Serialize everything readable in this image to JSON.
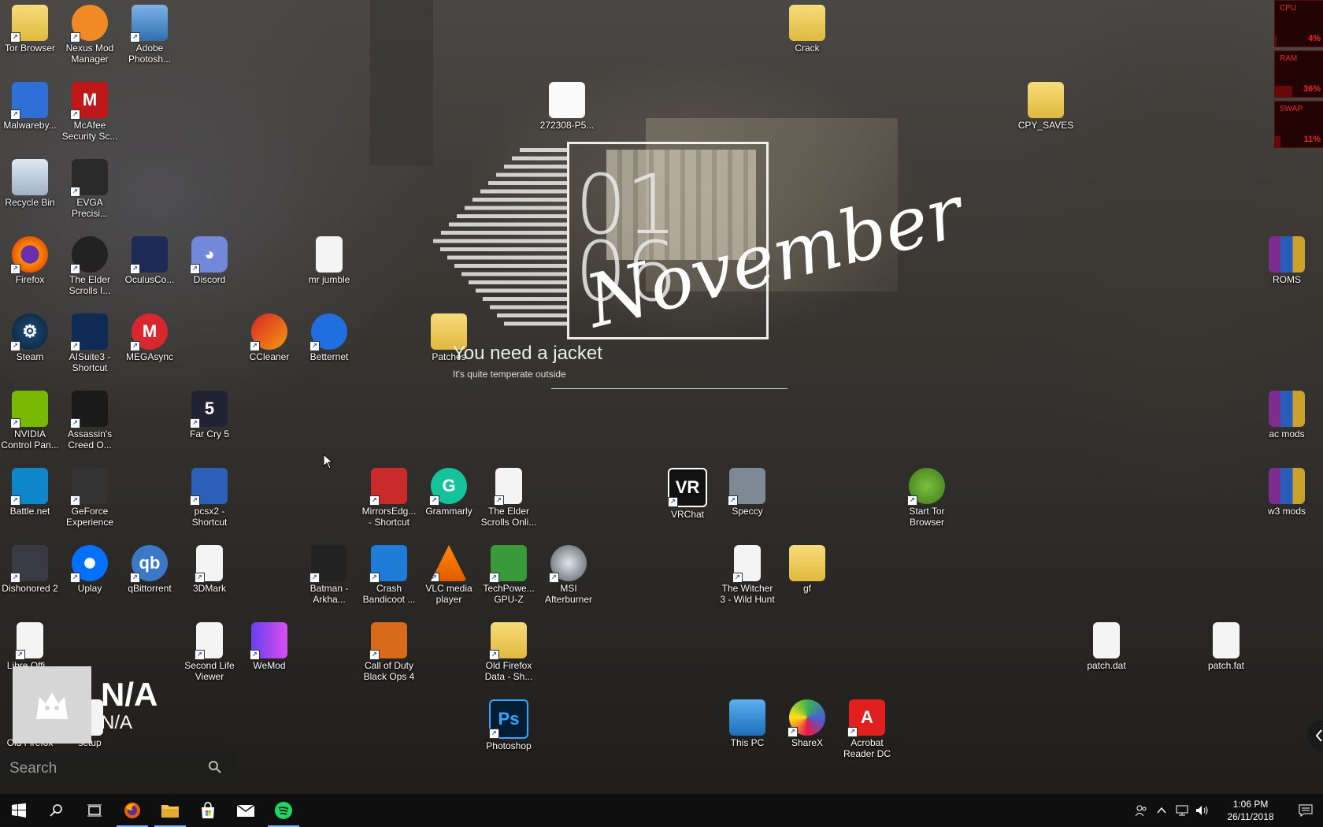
{
  "desktop": {
    "icons": [
      {
        "label": "Tor Browser",
        "type": "folder-green",
        "sc": true
      },
      {
        "label": "Nexus Mod\nManager",
        "type": "nexus",
        "sc": true
      },
      {
        "label": "Adobe\nPhotosh...",
        "type": "install",
        "sc": true
      },
      {
        "label": "Crack",
        "type": "folder",
        "sc": false
      },
      {
        "label": "Malwareby...",
        "type": "malware",
        "sc": true
      },
      {
        "label": "McAfee\nSecurity Sc...",
        "type": "mcafee",
        "sc": true
      },
      {
        "label": "272308-P5...",
        "type": "image",
        "sc": false
      },
      {
        "label": "CPY_SAVES",
        "type": "folder",
        "sc": false
      },
      {
        "label": "Recycle Bin",
        "type": "recycle",
        "sc": false
      },
      {
        "label": "EVGA\nPrecisi...",
        "type": "evga",
        "sc": true
      },
      {
        "label": "Firefox",
        "type": "firefox",
        "sc": true
      },
      {
        "label": "The Elder\nScrolls I...",
        "type": "elder",
        "sc": true
      },
      {
        "label": "OculusCo...",
        "type": "oculus",
        "sc": true
      },
      {
        "label": "Discord",
        "type": "discord",
        "sc": true
      },
      {
        "label": "mr jumble",
        "type": "doc",
        "sc": false
      },
      {
        "label": "ROMS",
        "type": "rar",
        "sc": false
      },
      {
        "label": "Steam",
        "type": "steam",
        "sc": true
      },
      {
        "label": "AISuite3 -\nShortcut",
        "type": "aisuite",
        "sc": true
      },
      {
        "label": "MEGAsync",
        "type": "mega",
        "sc": true
      },
      {
        "label": "CCleaner",
        "type": "ccleaner",
        "sc": true
      },
      {
        "label": "Betternet",
        "type": "betternet",
        "sc": true
      },
      {
        "label": "Patches",
        "type": "folder",
        "sc": false
      },
      {
        "label": "NVIDIA\nControl Pan...",
        "type": "nvidia",
        "sc": true
      },
      {
        "label": "Assassin's\nCreed O...",
        "type": "ac",
        "sc": true
      },
      {
        "label": "Far Cry 5",
        "type": "farcry",
        "sc": true
      },
      {
        "label": "ac mods",
        "type": "rar",
        "sc": false
      },
      {
        "label": "Battle.net",
        "type": "battlenet",
        "sc": true
      },
      {
        "label": "GeForce\nExperience",
        "type": "geforce",
        "sc": true
      },
      {
        "label": "pcsx2 -\nShortcut",
        "type": "pcsx2",
        "sc": true
      },
      {
        "label": "MirrorsEdg...\n- Shortcut",
        "type": "mirrors",
        "sc": true
      },
      {
        "label": "Grammarly",
        "type": "grammarly",
        "sc": true
      },
      {
        "label": "The Elder\nScrolls Onli...",
        "type": "doc",
        "sc": true
      },
      {
        "label": "VRChat",
        "type": "vrchat",
        "sc": true
      },
      {
        "label": "Speccy",
        "type": "speccy",
        "sc": true
      },
      {
        "label": "Start Tor\nBrowser",
        "type": "tor",
        "sc": true
      },
      {
        "label": "w3 mods",
        "type": "rar",
        "sc": false
      },
      {
        "label": "Dishonored 2",
        "type": "dishonored",
        "sc": true
      },
      {
        "label": "Uplay",
        "type": "uplay",
        "sc": true
      },
      {
        "label": "qBittorrent",
        "type": "qb",
        "sc": true
      },
      {
        "label": "3DMark",
        "type": "doc",
        "sc": true
      },
      {
        "label": "Batman -\nArkha...",
        "type": "batman",
        "sc": true
      },
      {
        "label": "Crash\nBandicoot ...",
        "type": "crash",
        "sc": true
      },
      {
        "label": "VLC media\nplayer",
        "type": "vlc",
        "sc": true
      },
      {
        "label": "TechPowe...\nGPU-Z",
        "type": "gpuz",
        "sc": true
      },
      {
        "label": "MSI\nAfterburner",
        "type": "msi",
        "sc": true
      },
      {
        "label": "The Witcher\n3 - Wild Hunt",
        "type": "doc",
        "sc": true
      },
      {
        "label": "gf",
        "type": "folder",
        "sc": false
      },
      {
        "label": "Libre Offi...",
        "type": "doc",
        "sc": true
      },
      {
        "label": "Second Life\nViewer",
        "type": "doc",
        "sc": true
      },
      {
        "label": "WeMod",
        "type": "wemod",
        "sc": true
      },
      {
        "label": "Call of Duty\nBlack Ops 4",
        "type": "cod",
        "sc": true
      },
      {
        "label": "Old Firefox\nData - Sh...",
        "type": "folder",
        "sc": true
      },
      {
        "label": "patch.dat",
        "type": "doc",
        "sc": false
      },
      {
        "label": "patch.fat",
        "type": "doc",
        "sc": false
      },
      {
        "label": "Old Firefox",
        "type": "doc",
        "sc": true
      },
      {
        "label": "setup",
        "type": "doc",
        "sc": true
      },
      {
        "label": "Photoshop",
        "type": "ps",
        "sc": true
      },
      {
        "label": "This PC",
        "type": "pc",
        "sc": false
      },
      {
        "label": "ShareX",
        "type": "sharex",
        "sc": true
      },
      {
        "label": "Acrobat\nReader DC",
        "type": "acrobat",
        "sc": true
      }
    ]
  },
  "clock_widget": {
    "day": "01",
    "hour": "06",
    "month": "November",
    "weather_headline": "You need a jacket",
    "weather_detail": "It's quite temperate outside"
  },
  "system_monitor": [
    {
      "label": "CPU",
      "value": "4%",
      "fill": 0.04
    },
    {
      "label": "RAM",
      "value": "36%",
      "fill": 0.36
    },
    {
      "label": "SWAP",
      "value": "11%",
      "fill": 0.11
    }
  ],
  "media_widget": {
    "title": "N/A",
    "subtitle": "N/A"
  },
  "search_widget": {
    "placeholder": "Search"
  },
  "taskbar": {
    "pinned": [
      "start",
      "search",
      "task-view",
      "firefox",
      "file-explorer",
      "store",
      "mail",
      "spotify"
    ],
    "clock_time": "1:06 PM",
    "clock_date": "26/11/2018"
  },
  "colors": {
    "taskbar_bg": "#0f0f0f",
    "monitor_red": "#e22222",
    "folder_yellow": "#f0cc5a"
  }
}
